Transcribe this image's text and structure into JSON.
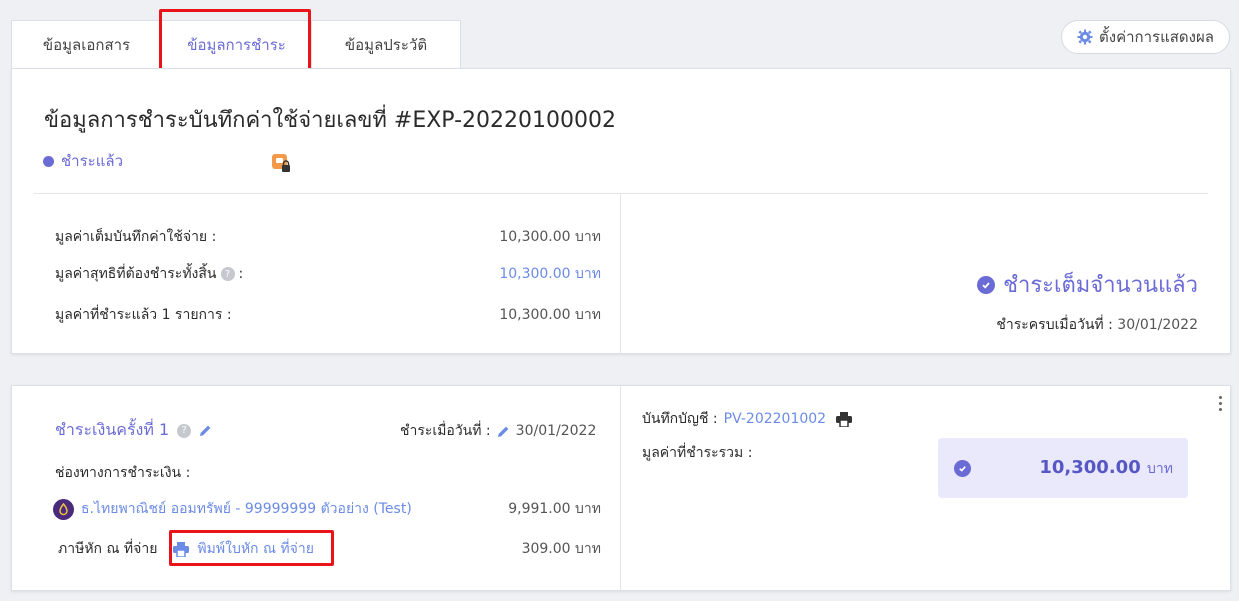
{
  "tabs": [
    {
      "label": "ข้อมูลเอกสาร"
    },
    {
      "label": "ข้อมูลการชำระ"
    },
    {
      "label": "ข้อมูลประวัติ"
    }
  ],
  "settings_button": {
    "label": "ตั้งค่าการแสดงผล",
    "icon": "gear-icon"
  },
  "header": {
    "title": "ข้อมูลการชำระบันทึกค่าใช้จ่ายเลขที่ #EXP-20220100002",
    "status": "ชำระแล้ว"
  },
  "summary": {
    "rows": [
      {
        "label": "มูลค่าเต็มบันทึกค่าใช้จ่าย :",
        "value": "10,300.00 บาท"
      },
      {
        "label": "มูลค่าสุทธิที่ต้องชำระทั้งสิ้น",
        "suffix": ":",
        "value": "10,300.00 บาท"
      },
      {
        "label": "มูลค่าที่ชำระแล้ว 1 รายการ :",
        "value": "10,300.00 บาท"
      }
    ],
    "full_paid": "ชำระเต็มจำนวนแล้ว",
    "paid_date_label": "ชำระครบเมื่อวันที่ :",
    "paid_date": "30/01/2022"
  },
  "payment": {
    "title": "ชำระเงินครั้งที่ 1",
    "date_label": "ชำระเมื่อวันที่ :",
    "date": "30/01/2022",
    "channel_label": "ช่องทางการชำระเงิน :",
    "bank_name": "ธ.ไทยพาณิชย์ ออมทรัพย์ - 99999999 ตัวอย่าง (Test)",
    "bank_amount": "9,991.00 บาท",
    "wht_label": "ภาษีหัก ณ ที่จ่าย",
    "print_wht": "พิมพ์ใบหัก ณ ที่จ่าย",
    "wht_amount": "309.00 บาท",
    "account_label": "บันทึกบัญชี :",
    "account_ref": "PV-202201002",
    "total_label": "มูลค่าที่ชำระรวม :",
    "total_amount": "10,300.00",
    "total_unit": "บาท"
  },
  "colors": {
    "accent": "#6b6bd6",
    "link": "#6b8be6",
    "highlight": "#e8141a"
  }
}
